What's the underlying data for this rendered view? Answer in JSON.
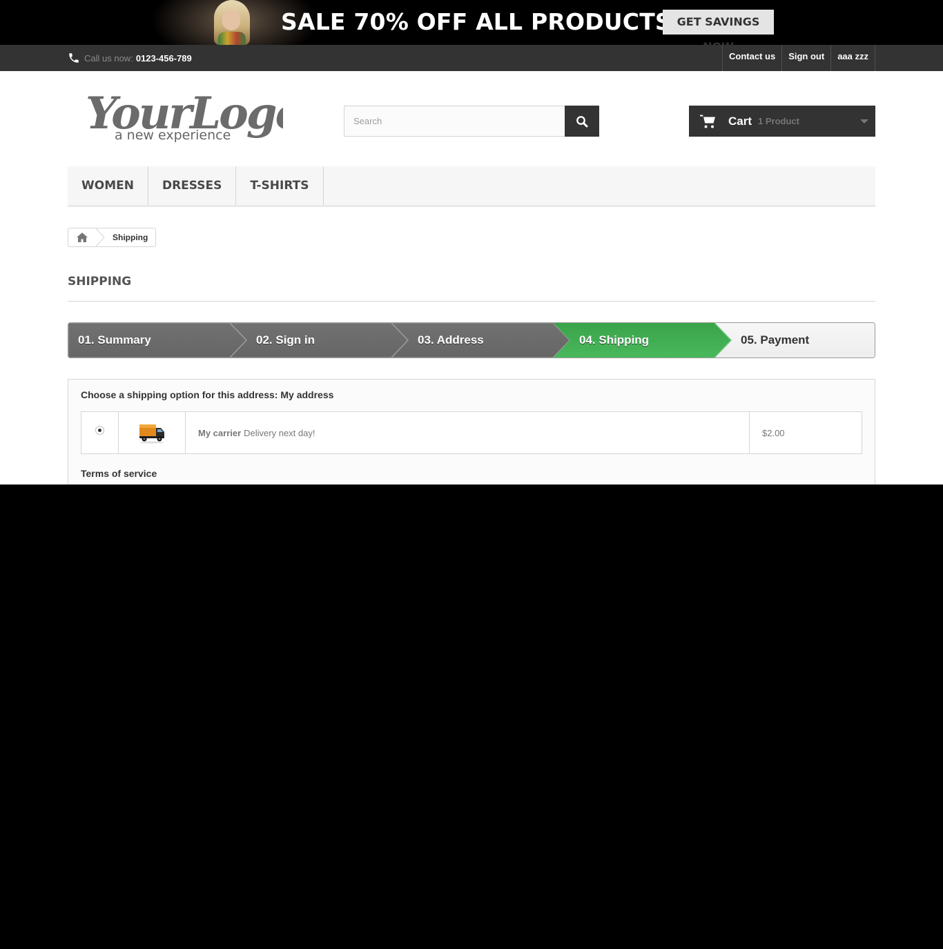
{
  "banner": {
    "title": "SALE 70% OFF ALL PRODUCTS",
    "cta": "GET SAVINGS NOW"
  },
  "topbar": {
    "call_label": "Call us now:",
    "phone": "0123-456-789",
    "nav": [
      "Contact us",
      "Sign out",
      "aaa zzz"
    ]
  },
  "header": {
    "logo_text": "YourLogo",
    "logo_tagline": "a new experience",
    "search_placeholder": "Search",
    "cart_label": "Cart",
    "cart_count": "1 Product"
  },
  "menu": [
    "WOMEN",
    "DRESSES",
    "T-SHIRTS"
  ],
  "breadcrumb": {
    "current": "Shipping"
  },
  "page_heading": "SHIPPING",
  "steps": [
    {
      "label": "01. Summary",
      "state": "done"
    },
    {
      "label": "02. Sign in",
      "state": "done"
    },
    {
      "label": "03. Address",
      "state": "done"
    },
    {
      "label": "04. Shipping",
      "state": "current"
    },
    {
      "label": "05. Payment",
      "state": "todo"
    }
  ],
  "colors": {
    "step_done": "#666666",
    "step_current": "#43b155",
    "step_todo": "#f1f1f1",
    "dark": "#333333"
  },
  "shipping": {
    "title_prefix": "Choose a shipping option for this address:",
    "address_name": "My address",
    "carrier": {
      "selected": true,
      "name": "My carrier",
      "description": "Delivery next day!",
      "price": "$2.00",
      "icon": "delivery-truck-icon"
    },
    "terms_title": "Terms of service"
  }
}
